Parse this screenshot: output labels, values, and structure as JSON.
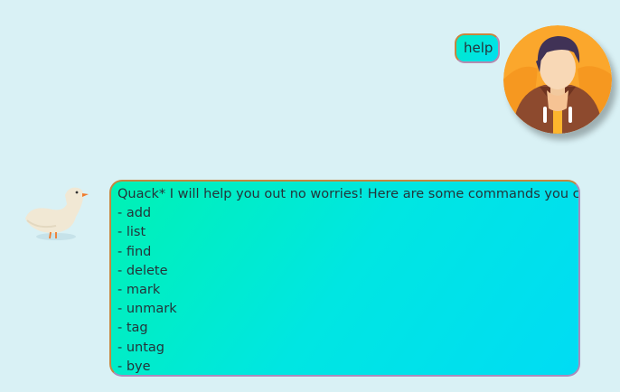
{
  "user": {
    "message": "help",
    "avatar_icon": "user-avatar-icon"
  },
  "duck": {
    "avatar_icon": "duck-icon",
    "intro": "Quack* I will help you out no worries! Here are some commands you can use",
    "commands": [
      "- add",
      "- list",
      "- find",
      "- delete",
      "- mark",
      "- unmark",
      "- tag",
      "- untag",
      "- bye"
    ]
  },
  "colors": {
    "background": "#d9f1f5",
    "bubble_gradient_start": "#00f2b4",
    "bubble_gradient_end": "#00dcf4",
    "bubble_border": "#c8863e"
  }
}
